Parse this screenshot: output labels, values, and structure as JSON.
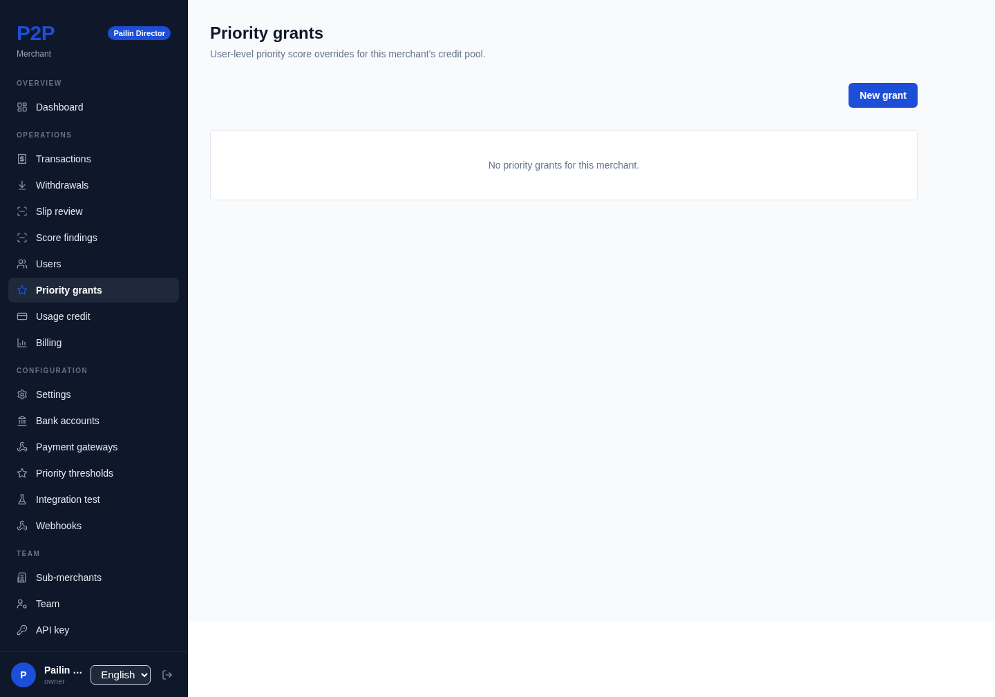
{
  "sidebar": {
    "logo": "P2P",
    "subtitle": "Merchant",
    "role_badge": "Pailin Director",
    "sections": [
      {
        "heading": "OVERVIEW",
        "items": [
          {
            "label": "Dashboard",
            "selected": false
          }
        ]
      },
      {
        "heading": "OPERATIONS",
        "items": [
          {
            "label": "Transactions",
            "selected": false
          },
          {
            "label": "Withdrawals",
            "selected": false
          },
          {
            "label": "Slip review",
            "selected": false
          },
          {
            "label": "Score findings",
            "selected": false
          },
          {
            "label": "Users",
            "selected": false
          },
          {
            "label": "Priority grants",
            "selected": true
          },
          {
            "label": "Usage credit",
            "selected": false
          },
          {
            "label": "Billing",
            "selected": false
          }
        ]
      },
      {
        "heading": "CONFIGURATION",
        "items": [
          {
            "label": "Settings",
            "selected": false
          },
          {
            "label": "Bank accounts",
            "selected": false
          },
          {
            "label": "Payment gateways",
            "selected": false
          },
          {
            "label": "Priority thresholds",
            "selected": false
          },
          {
            "label": "Integration test",
            "selected": false
          },
          {
            "label": "Webhooks",
            "selected": false
          }
        ]
      },
      {
        "heading": "TEAM",
        "items": [
          {
            "label": "Sub-merchants",
            "selected": false
          },
          {
            "label": "Team",
            "selected": false
          },
          {
            "label": "API key",
            "selected": false
          }
        ]
      }
    ],
    "user": {
      "avatar_initial": "P",
      "name": "Pailin …",
      "role": "owner"
    },
    "language_select": {
      "value": "English"
    }
  },
  "page": {
    "title": "Priority grants",
    "description": "User-level priority score overrides for this merchant's credit pool.",
    "new_button": "New grant",
    "empty_message": "No priority grants for this merchant."
  }
}
